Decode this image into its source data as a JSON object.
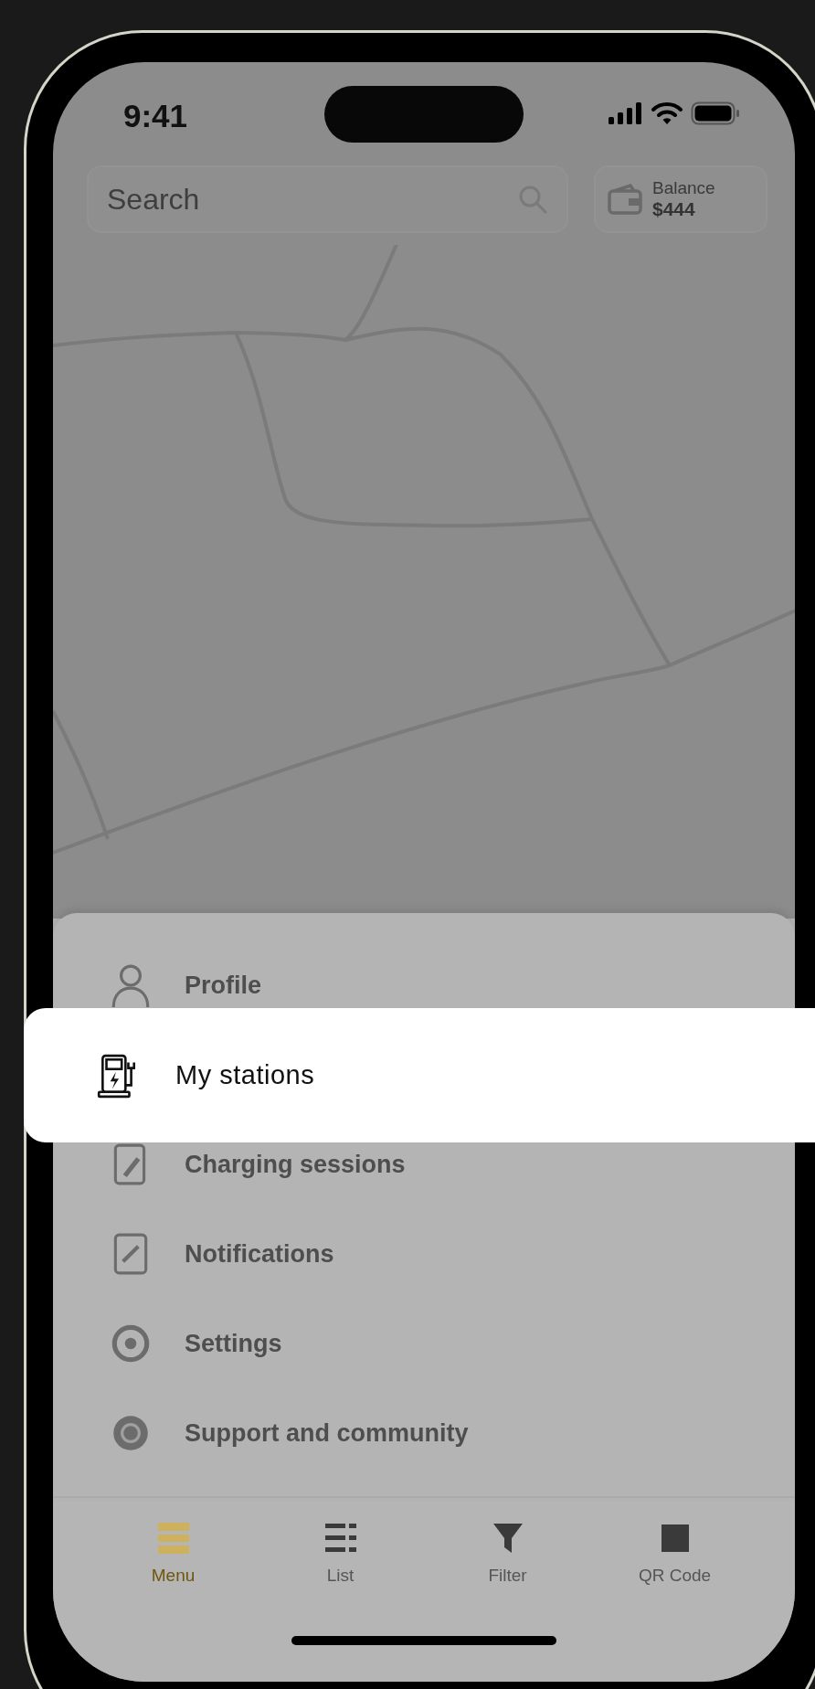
{
  "status_bar": {
    "time": "9:41"
  },
  "search": {
    "placeholder": "Search"
  },
  "balance": {
    "label": "Balance",
    "amount": "$444"
  },
  "menu": {
    "items": [
      {
        "kind": "profile",
        "label": "Profile",
        "selected": false
      },
      {
        "kind": "stations",
        "label": "My stations",
        "selected": true
      },
      {
        "kind": "sessions",
        "label": "Charging sessions",
        "selected": false
      },
      {
        "kind": "notifications",
        "label": "Notifications",
        "selected": false
      },
      {
        "kind": "settings",
        "label": "Settings",
        "selected": false
      },
      {
        "kind": "support",
        "label": "Support and community",
        "selected": false
      }
    ]
  },
  "tab_bar": {
    "tabs": [
      {
        "kind": "menu",
        "label": "Menu",
        "selected": true
      },
      {
        "kind": "list",
        "label": "List",
        "selected": false
      },
      {
        "kind": "filter",
        "label": "Filter",
        "selected": false
      },
      {
        "kind": "qr",
        "label": "QR Code",
        "selected": false
      }
    ]
  }
}
